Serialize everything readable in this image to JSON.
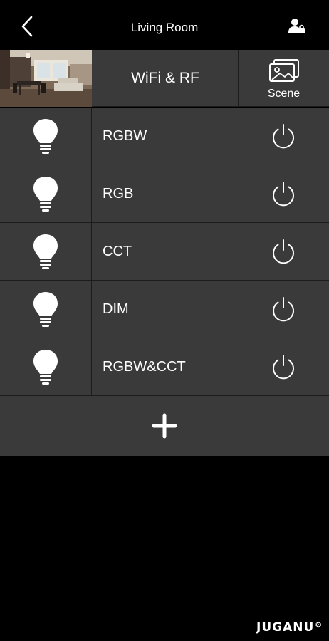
{
  "header": {
    "title": "Living Room",
    "back_icon": "chevron-left-icon",
    "user_icon": "user-lock-icon"
  },
  "summary": {
    "photo": "living-room-photo",
    "mode_label": "WiFi & RF",
    "scene_label": "Scene",
    "scene_icon": "gallery-icon"
  },
  "devices": [
    {
      "name": "RGBW",
      "icon": "bulb-icon",
      "power_icon": "power-icon"
    },
    {
      "name": "RGB",
      "icon": "bulb-icon",
      "power_icon": "power-icon"
    },
    {
      "name": "CCT",
      "icon": "bulb-icon",
      "power_icon": "power-icon"
    },
    {
      "name": "DIM",
      "icon": "bulb-icon",
      "power_icon": "power-icon"
    },
    {
      "name": "RGBW&CCT",
      "icon": "bulb-icon",
      "power_icon": "power-icon"
    }
  ],
  "add_icon": "plus-icon",
  "brand": {
    "name": "JUGANU"
  },
  "colors": {
    "background": "#000000",
    "row": "#3a3a3a",
    "divider": "#1c1c1c",
    "text": "#ffffff"
  }
}
